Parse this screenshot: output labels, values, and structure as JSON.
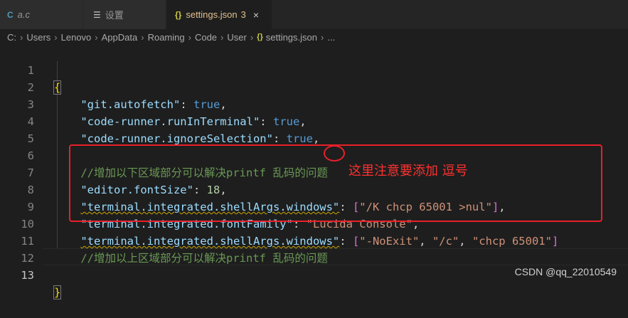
{
  "tabs": [
    {
      "icon": "C",
      "label": "a.c"
    },
    {
      "icon": "☰",
      "label": "设置"
    },
    {
      "icon": "{}",
      "label": "settings.json",
      "badge": "3",
      "close": "×"
    }
  ],
  "breadcrumb": [
    "C:",
    "Users",
    "Lenovo",
    "AppData",
    "Roaming",
    "Code",
    "User",
    "settings.json",
    "..."
  ],
  "breadcrumb_file_icon": "{}",
  "lines": [
    {
      "num": "1"
    },
    {
      "num": "2"
    },
    {
      "num": "3"
    },
    {
      "num": "4"
    },
    {
      "num": "5"
    },
    {
      "num": "6"
    },
    {
      "num": "7"
    },
    {
      "num": "8"
    },
    {
      "num": "9"
    },
    {
      "num": "10"
    },
    {
      "num": "11"
    },
    {
      "num": "12"
    },
    {
      "num": "13"
    }
  ],
  "code": {
    "open_brace": "{",
    "close_brace": "}",
    "l2_key": "\"git.autofetch\"",
    "l2_val": "true",
    "l3_key": "\"code-runner.runInTerminal\"",
    "l3_val": "true",
    "l4_key": "\"code-runner.ignoreSelection\"",
    "l4_val": "true",
    "l6_comment": "//增加以下区域部分可以解决printf 乱码的问题",
    "l7_key": "\"editor.fontSize\"",
    "l7_val": "18",
    "l8_key": "\"terminal.integrated.shellArgs.windows\"",
    "l8_val": "\"/K chcp 65001 >nul\"",
    "l9_key": "\"terminal.integrated.fontFamily\"",
    "l9_val": "\"Lucida Console\"",
    "l10_key": "\"terminal.integrated.shellArgs.windows\"",
    "l10_v1": "\"-NoExit\"",
    "l10_v2": "\"/c\"",
    "l10_v3": "\"chcp 65001\"",
    "l11_comment": "//增加以上区域部分可以解决printf 乱码的问题"
  },
  "annotation": "这里注意要添加 逗号",
  "watermark": "CSDN @qq_22010549",
  "colors": {
    "background": "#1e1e1e",
    "key": "#9cdcfe",
    "string": "#ce9178",
    "keyword": "#569cd6",
    "number": "#b5cea8",
    "comment": "#6a9955",
    "annotation_red": "#e8202a"
  }
}
